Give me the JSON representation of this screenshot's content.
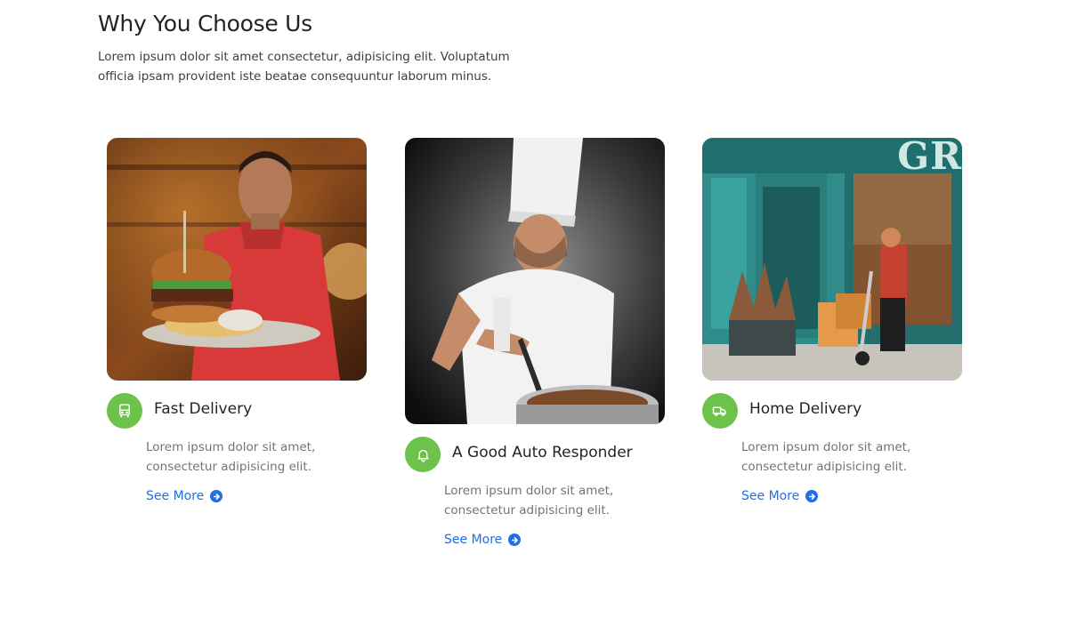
{
  "section": {
    "title": "Why You Choose Us",
    "subtitle": "Lorem ipsum dolor sit amet consectetur, adipisicing elit. Voluptatum officia ipsam provident iste beatae consequuntur laborum minus."
  },
  "cards": [
    {
      "title": "Fast Delivery",
      "text": "Lorem ipsum dolor sit amet, consectetur adipisicing elit.",
      "link": "See More",
      "icon": "bus-icon"
    },
    {
      "title": "A Good Auto Responder",
      "text": "Lorem ipsum dolor sit amet, consectetur adipisicing elit.",
      "link": "See More",
      "icon": "bell-icon"
    },
    {
      "title": "Home Delivery",
      "text": "Lorem ipsum dolor sit amet, consectetur adipisicing elit.",
      "link": "See More",
      "icon": "truck-icon"
    }
  ],
  "storefront_sign": "GR",
  "colors": {
    "accent_green": "#6cc24a",
    "link_blue": "#1f6fe5"
  }
}
